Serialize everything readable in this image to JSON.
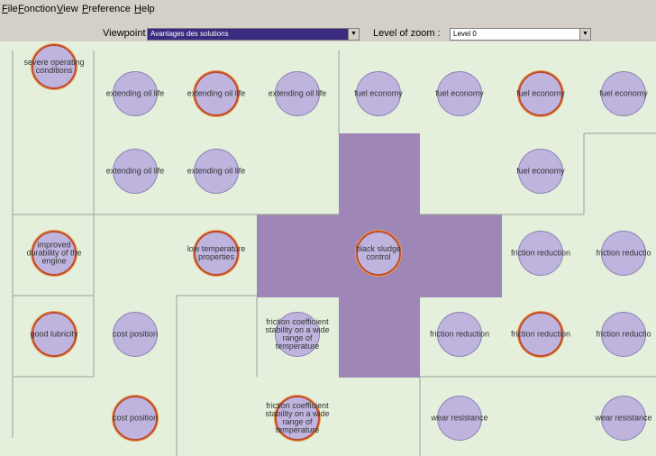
{
  "menu": [
    "File",
    "Fonction",
    "View",
    "Preference",
    "Help"
  ],
  "toolbar": {
    "viewpoint_label": "Viewpoint",
    "viewpoint_value": "Avantages des solutions",
    "zoom_label": "Level of zoom :",
    "zoom_value": "Level 0"
  },
  "colors": {
    "map_background": "#e4efdc",
    "highlight": "#9e86b7",
    "node_fill": "#beb4de",
    "selected_ring": "#c04a32"
  },
  "nodes": [
    {
      "label": "severe operating\nconditions",
      "ring": true
    },
    {
      "label": "extending oil life",
      "ring": false
    },
    {
      "label": "extending oil life",
      "ring": true
    },
    {
      "label": "extending oil life",
      "ring": false
    },
    {
      "label": "fuel economy",
      "ring": false
    },
    {
      "label": "fuel economy",
      "ring": false
    },
    {
      "label": "fuel economy",
      "ring": true
    },
    {
      "label": "fuel economy",
      "ring": false
    },
    {
      "label": "extending oil life",
      "ring": false
    },
    {
      "label": "extending oil life",
      "ring": false
    },
    {
      "label": "fuel economy",
      "ring": false
    },
    {
      "label": "improved\ndurability of the\nengine",
      "ring": true
    },
    {
      "label": "low temperature\nproperties",
      "ring": true
    },
    {
      "label": "black sludge\ncontrol",
      "ring": true
    },
    {
      "label": "friction reduction",
      "ring": false
    },
    {
      "label": "friction reductio",
      "ring": false
    },
    {
      "label": "good lubricity",
      "ring": true
    },
    {
      "label": "cost position",
      "ring": false
    },
    {
      "label": "friction coefficient\nstability on a wide\nrange of\ntemperature",
      "ring": false
    },
    {
      "label": "friction reduction",
      "ring": false
    },
    {
      "label": "friction reduction",
      "ring": true
    },
    {
      "label": "friction reductio",
      "ring": false
    },
    {
      "label": "cost position",
      "ring": true
    },
    {
      "label": "friction coefficient\nstability on a wide\nrange of\ntemperature",
      "ring": true
    },
    {
      "label": "wear resistance",
      "ring": false
    },
    {
      "label": "wear resistance",
      "ring": false
    }
  ]
}
